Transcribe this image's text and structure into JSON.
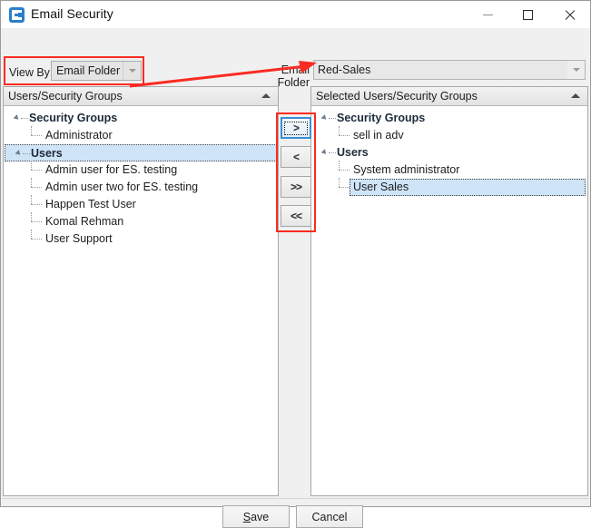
{
  "window": {
    "title": "Email Security",
    "icon": "email-security-app-icon",
    "controls": {
      "minimize": "minimize-icon",
      "maximize": "maximize-icon",
      "close": "close-icon"
    }
  },
  "toolbar": {
    "view_by_label": "View By",
    "view_by_value": "Email Folder",
    "email_folder_label": "Email Folder",
    "email_folder_value": "Red-Sales"
  },
  "annotation": {
    "color": "#fa2b22",
    "shapes": [
      "view-by-highlight-box",
      "arrow-to-email-folder",
      "transfer-buttons-highlight-box"
    ]
  },
  "left_panel": {
    "header": "Users/Security Groups",
    "collapse_icon": "collapse-up-icon",
    "nodes": [
      {
        "label": "Security Groups",
        "type": "group",
        "selected": false
      },
      {
        "label": "Administrator",
        "type": "child",
        "selected": false
      },
      {
        "label": "Users",
        "type": "group",
        "selected": true
      },
      {
        "label": "Admin user for ES. testing",
        "type": "child",
        "selected": false
      },
      {
        "label": "Admin user two for ES. testing",
        "type": "child",
        "selected": false
      },
      {
        "label": "Happen Test User",
        "type": "child",
        "selected": false
      },
      {
        "label": "Komal Rehman",
        "type": "child",
        "selected": false
      },
      {
        "label": "User Support",
        "type": "child",
        "selected": false
      }
    ]
  },
  "right_panel": {
    "header": "Selected Users/Security Groups",
    "collapse_icon": "collapse-up-icon",
    "nodes": [
      {
        "label": "Security Groups",
        "type": "group",
        "selected": false
      },
      {
        "label": "sell in adv",
        "type": "child",
        "selected": false
      },
      {
        "label": "Users",
        "type": "group",
        "selected": false
      },
      {
        "label": "System administrator",
        "type": "child",
        "selected": false
      },
      {
        "label": "User Sales",
        "type": "child",
        "selected": true
      }
    ]
  },
  "transfer_buttons": [
    {
      "label": ">",
      "name": "move-right-button",
      "focused": true
    },
    {
      "label": "<",
      "name": "move-left-button",
      "focused": false
    },
    {
      "label": ">>",
      "name": "move-all-right-button",
      "focused": false
    },
    {
      "label": "<<",
      "name": "move-all-left-button",
      "focused": false
    }
  ],
  "footer": {
    "save_accel": "S",
    "save_rest": "ave",
    "cancel": "Cancel"
  }
}
